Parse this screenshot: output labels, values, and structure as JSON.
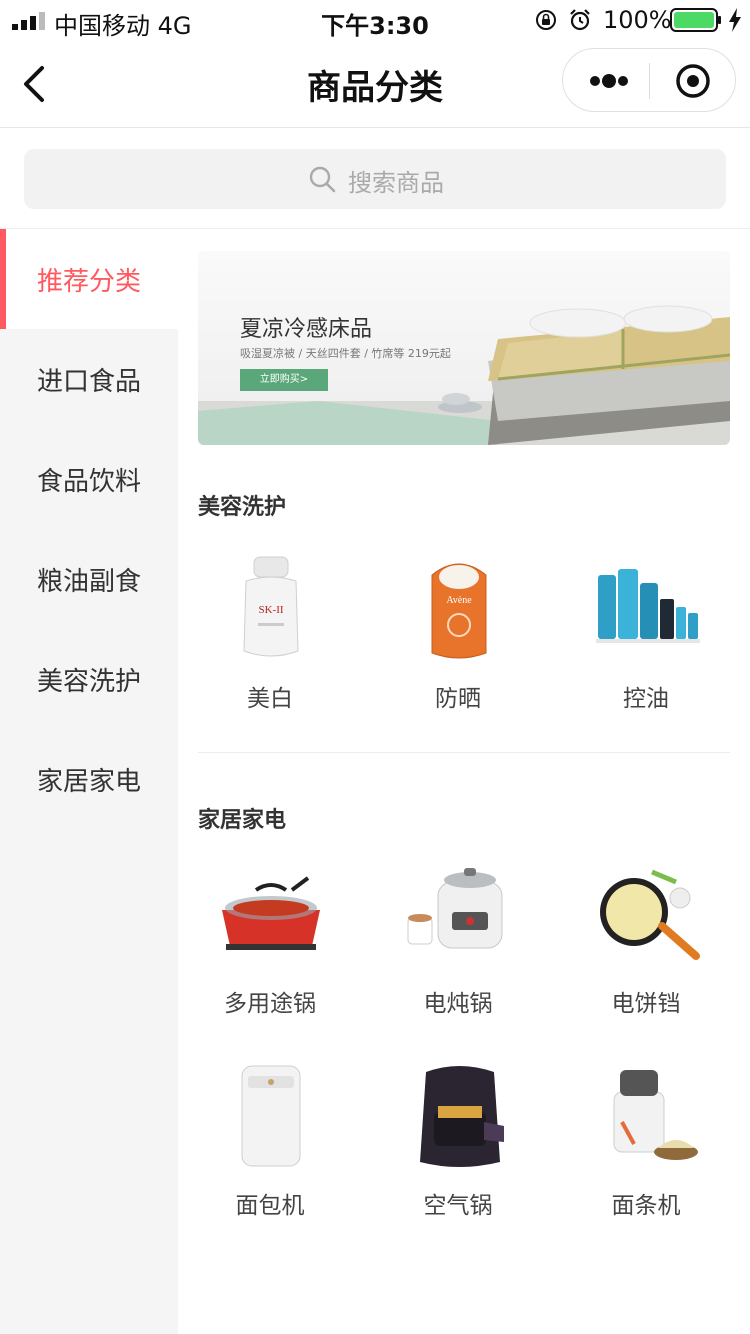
{
  "status_bar": {
    "carrier": "中国移动  4G",
    "time": "下午3:30",
    "battery": "100%"
  },
  "nav": {
    "title": "商品分类"
  },
  "search": {
    "placeholder": "搜索商品"
  },
  "sidebar": {
    "items": [
      {
        "label": "推荐分类"
      },
      {
        "label": "进口食品"
      },
      {
        "label": "食品饮料"
      },
      {
        "label": "粮油副食"
      },
      {
        "label": "美容洗护"
      },
      {
        "label": "家居家电"
      }
    ],
    "active_color": "#ff5a5f"
  },
  "banner": {
    "title": "夏凉冷感床品",
    "subtitle": "吸湿夏凉被 / 天丝四件套 / 竹席等 219元起",
    "button": "立即购买>"
  },
  "sections": [
    {
      "title": "美容洗护",
      "products": [
        {
          "label": "美白",
          "icon": "serum-bottle-icon"
        },
        {
          "label": "防晒",
          "icon": "sunscreen-icon"
        },
        {
          "label": "控油",
          "icon": "skincare-set-icon"
        }
      ]
    },
    {
      "title": "家居家电",
      "products": [
        {
          "label": "多用途锅",
          "icon": "electric-hot-pot-icon"
        },
        {
          "label": "电炖锅",
          "icon": "electric-stew-pot-icon"
        },
        {
          "label": "电饼铛",
          "icon": "crepe-maker-icon"
        },
        {
          "label": "面包机",
          "icon": "bread-maker-icon"
        },
        {
          "label": "空气锅",
          "icon": "air-fryer-icon"
        },
        {
          "label": "面条机",
          "icon": "noodle-maker-icon"
        }
      ]
    }
  ]
}
